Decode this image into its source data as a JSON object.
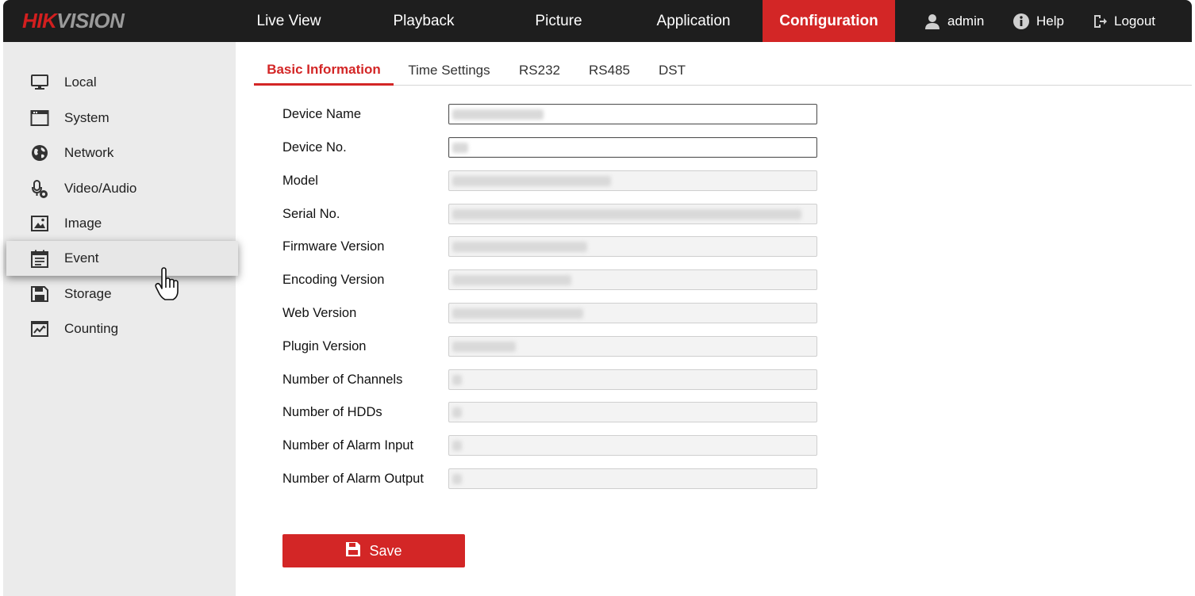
{
  "brand": {
    "logo_part1": "HIK",
    "logo_part2": "VISION"
  },
  "nav": {
    "items": [
      "Live View",
      "Playback",
      "Picture",
      "Application",
      "Configuration"
    ],
    "active": "Configuration",
    "user": "admin",
    "help": "Help",
    "logout": "Logout"
  },
  "sidebar": {
    "items": [
      {
        "label": "Local",
        "icon": "monitor-icon"
      },
      {
        "label": "System",
        "icon": "window-icon"
      },
      {
        "label": "Network",
        "icon": "globe-icon"
      },
      {
        "label": "Video/Audio",
        "icon": "microphone-icon"
      },
      {
        "label": "Image",
        "icon": "image-icon"
      },
      {
        "label": "Event",
        "icon": "calendar-icon"
      },
      {
        "label": "Storage",
        "icon": "floppy-icon"
      },
      {
        "label": "Counting",
        "icon": "chart-icon"
      }
    ],
    "active": "Event"
  },
  "tabs": {
    "items": [
      "Basic Information",
      "Time Settings",
      "RS232",
      "RS485",
      "DST"
    ],
    "active": "Basic Information"
  },
  "form": {
    "fields": [
      {
        "label": "Device Name",
        "value": "",
        "editable": true
      },
      {
        "label": "Device No.",
        "value": "",
        "editable": true
      },
      {
        "label": "Model",
        "value": "",
        "editable": false
      },
      {
        "label": "Serial No.",
        "value": "",
        "editable": false
      },
      {
        "label": "Firmware Version",
        "value": "",
        "editable": false
      },
      {
        "label": "Encoding Version",
        "value": "",
        "editable": false
      },
      {
        "label": "Web Version",
        "value": "",
        "editable": false
      },
      {
        "label": "Plugin Version",
        "value": "",
        "editable": false
      },
      {
        "label": "Number of Channels",
        "value": "",
        "editable": false
      },
      {
        "label": "Number of HDDs",
        "value": "",
        "editable": false
      },
      {
        "label": "Number of Alarm Input",
        "value": "",
        "editable": false
      },
      {
        "label": "Number of Alarm Output",
        "value": "",
        "editable": false
      }
    ],
    "save_label": "Save"
  },
  "colors": {
    "accent": "#d32626",
    "topbar": "#1e1e1e",
    "sidebar": "#ebebeb"
  }
}
